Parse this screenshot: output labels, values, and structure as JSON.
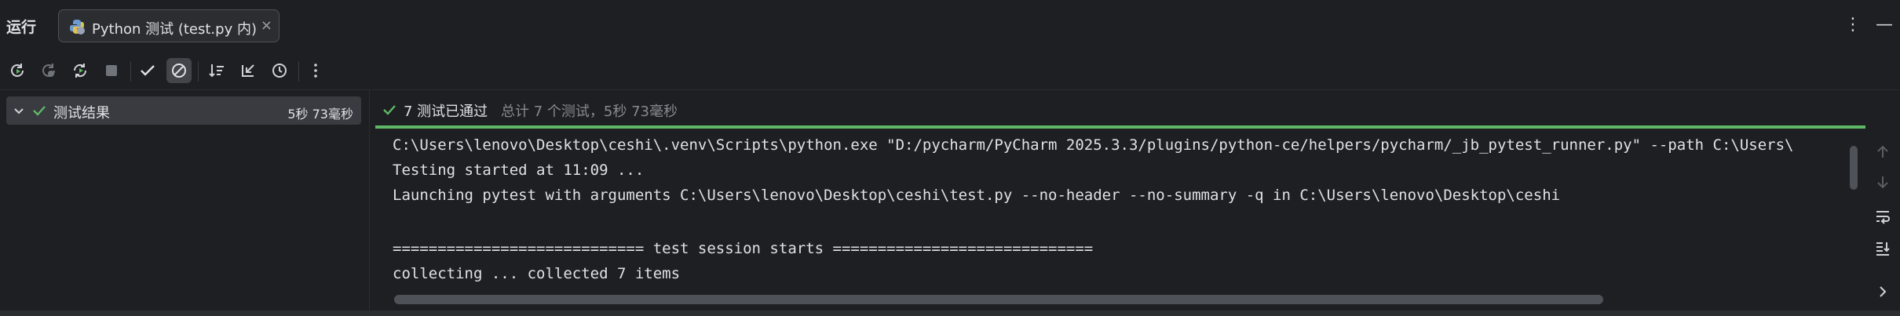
{
  "header": {
    "title": "运行",
    "tab_label": "Python 测试 (test.py 内)",
    "tab_close": "×",
    "menu_icon": "⋮",
    "minimize_icon": "—"
  },
  "toolbar": {
    "items": [
      "rerun-icon",
      "rerun-failed-icon",
      "toggle-auto-test-icon",
      "stop-icon",
      "show-passed-icon",
      "show-ignored-icon",
      "sort-alphabetically-icon",
      "collapse-all-icon",
      "history-icon",
      "more-options-icon"
    ]
  },
  "tree": {
    "root_label": "测试结果",
    "root_duration": "5秒 73毫秒"
  },
  "status": {
    "passed_text": "7 测试已通过",
    "summary_text": "总计 7 个测试，5秒 73毫秒"
  },
  "console": {
    "lines": [
      "C:\\Users\\lenovo\\Desktop\\ceshi\\.venv\\Scripts\\python.exe \"D:/pycharm/PyCharm 2025.3.3/plugins/python-ce/helpers/pycharm/_jb_pytest_runner.py\" --path C:\\Users\\",
      "Testing started at 11:09 ...",
      "Launching pytest with arguments C:\\Users\\lenovo\\Desktop\\ceshi\\test.py --no-header --no-summary -q in C:\\Users\\lenovo\\Desktop\\ceshi",
      "============================ test session starts =============================",
      "collecting ... collected 7 items"
    ]
  },
  "colors": {
    "background": "#1e1f22",
    "success": "#5fb865",
    "muted_text": "#868a91"
  }
}
